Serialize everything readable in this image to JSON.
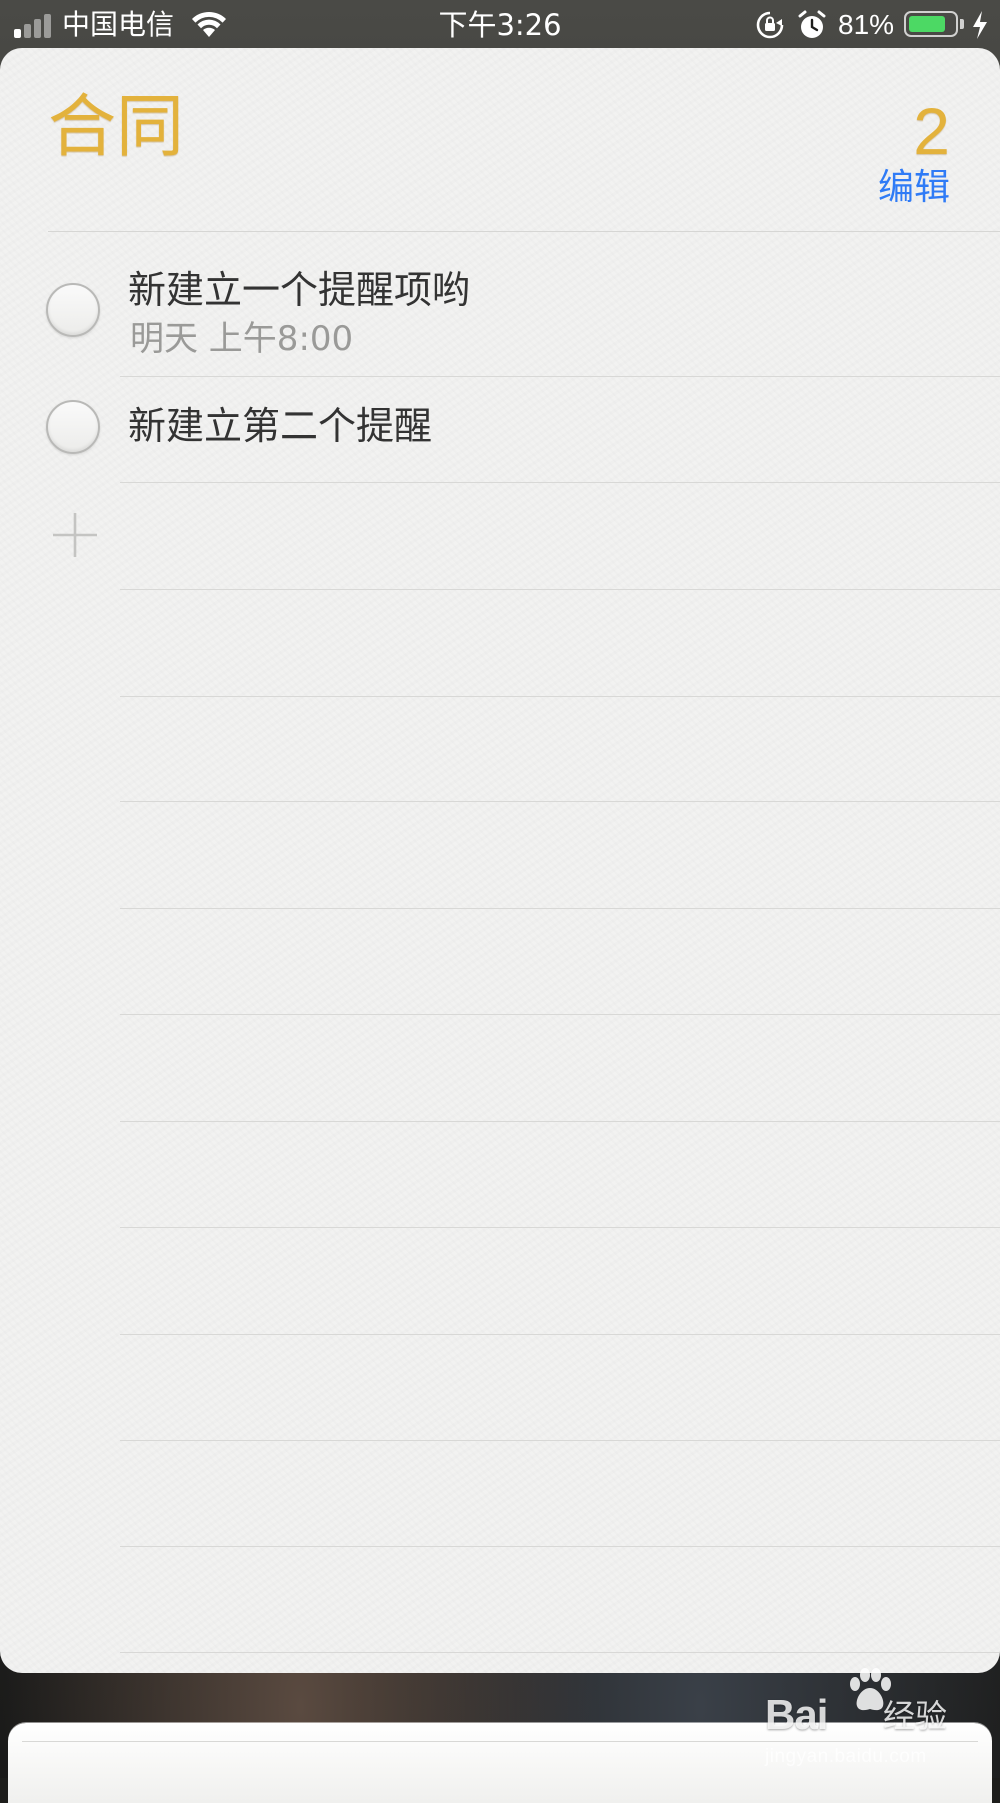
{
  "status_bar": {
    "carrier": "中国电信",
    "time": "下午3:26",
    "battery_percent_text": "81%",
    "battery_level": 0.81,
    "signal_bars_active": 1,
    "signal_bars_total": 4,
    "icons": [
      "signal-icon",
      "wifi-icon",
      "orientation-lock-icon",
      "alarm-icon",
      "battery-icon",
      "charging-bolt-icon"
    ]
  },
  "list": {
    "title": "合同",
    "count": "2",
    "edit_label": "编辑",
    "accent_color": "#e3b23c",
    "link_color": "#2f7bf6"
  },
  "reminders": [
    {
      "title": "新建立一个提醒项哟",
      "due": "明天 上午8:00"
    },
    {
      "title": "新建立第二个提醒",
      "due": ""
    }
  ],
  "watermark": {
    "brand": "Bai",
    "brand_suffix": "经验",
    "url": "jingyan.baidu.com"
  }
}
